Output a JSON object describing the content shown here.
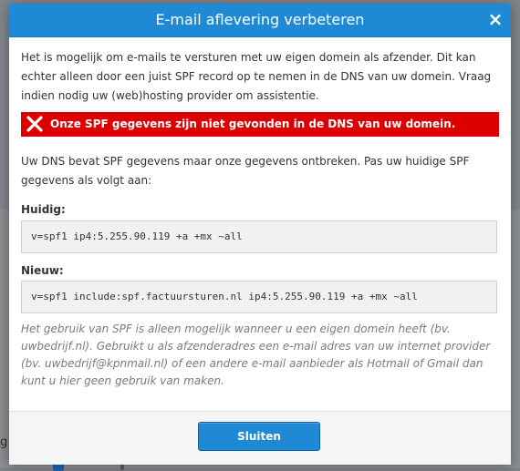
{
  "dialog": {
    "title": "E-mail aflevering verbeteren",
    "close_glyph": "×",
    "intro": "Het is mogelijk om e-mails te versturen met uw eigen domein als afzender. Dit kan echter alleen door een juist SPF record op te nemen in de DNS van uw domein. Vraag indien nodig uw (web)hosting provider om assistentie.",
    "alert": {
      "text": "Onze SPF gegevens zijn niet gevonden in de DNS van uw domein.",
      "icon": "x-icon",
      "color": "#dd0000"
    },
    "description": "Uw DNS bevat SPF gegevens maar onze gegevens ontbreken. Pas uw huidige SPF gegevens als volgt aan:",
    "current_label": "Huidig:",
    "current_value": "v=spf1 ip4:5.255.90.119 +a +mx ~all",
    "new_label": "Nieuw:",
    "new_value": "v=spf1 include:spf.factuursturen.nl ip4:5.255.90.119 +a +mx ~all",
    "note": "Het gebruik van SPF is alleen mogelijk wanneer u een eigen domein heeft (bv. uwbedrijf.nl). Gebruikt u als afzenderadres een e-mail adres van uw internet provider (bv. uwbedrijf@kpnmail.nl) of een andere e-mail aanbieder als Hotmail of Gmail dan kunt u hier geen gebruik van maken.",
    "close_button_label": "Sluiten",
    "accent_color": "#1e8ad6"
  },
  "background": {
    "stub_text": "g"
  }
}
